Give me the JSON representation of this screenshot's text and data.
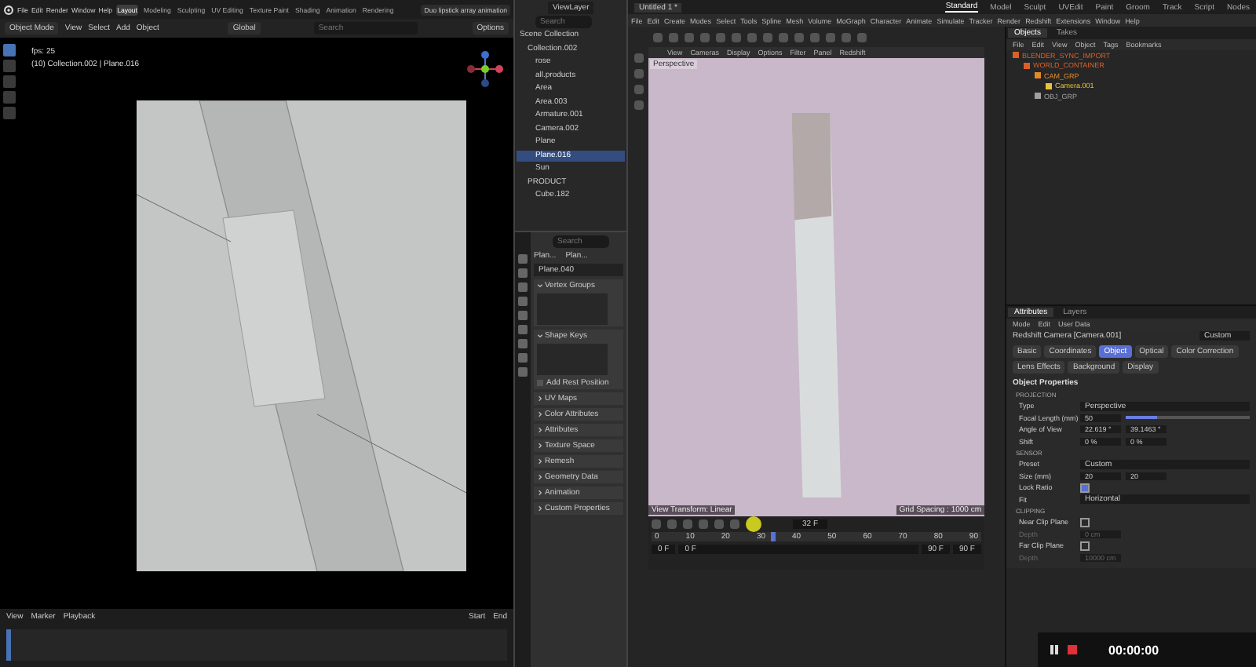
{
  "blender": {
    "menus": [
      "File",
      "Edit",
      "Render",
      "Window",
      "Help"
    ],
    "workspaces": [
      {
        "label": "Layout",
        "selected": true
      },
      {
        "label": "Modeling",
        "selected": false
      },
      {
        "label": "Sculpting",
        "selected": false
      },
      {
        "label": "UV Editing",
        "selected": false
      },
      {
        "label": "Texture Paint",
        "selected": false
      },
      {
        "label": "Shading",
        "selected": false
      },
      {
        "label": "Animation",
        "selected": false
      },
      {
        "label": "Rendering",
        "selected": false
      }
    ],
    "scene": "Duo lipstick array animation",
    "header": {
      "mode": "Object Mode",
      "menus": [
        "View",
        "Select",
        "Add",
        "Object"
      ],
      "orientation": "Global",
      "options": "Options",
      "search_placeholder": "Search"
    },
    "viewport": {
      "fps": "fps: 25",
      "context": "(10) Collection.002 | Plane.016"
    },
    "timeline": {
      "menus": [
        "View",
        "Marker",
        "Playback"
      ],
      "start_label": "Start",
      "end_label": "End"
    }
  },
  "outliner": {
    "view_layer": "ViewLayer",
    "search_placeholder": "Search",
    "tree": [
      {
        "label": "Scene Collection",
        "selected": false,
        "children": [
          {
            "label": "Collection.002",
            "selected": false,
            "children": [
              {
                "label": "rose",
                "selected": false
              },
              {
                "label": "all.products",
                "selected": false
              },
              {
                "label": "Area",
                "selected": false
              },
              {
                "label": "Area.003",
                "selected": false
              },
              {
                "label": "Armature.001",
                "selected": false
              },
              {
                "label": "Camera.002",
                "selected": false
              },
              {
                "label": "Plane",
                "selected": false
              },
              {
                "label": "Plane.016",
                "selected": true
              },
              {
                "label": "Sun",
                "selected": false
              }
            ]
          },
          {
            "label": "PRODUCT",
            "selected": false,
            "children": [
              {
                "label": "Cube.182",
                "selected": false
              }
            ]
          }
        ]
      }
    ]
  },
  "properties": {
    "search_placeholder": "Search",
    "breadcrumbs": [
      "Plan...",
      "Plan..."
    ],
    "mesh_name": "Plane.040",
    "panels": [
      {
        "title": "Vertex Groups",
        "expanded": true
      },
      {
        "title": "Shape Keys",
        "expanded": true,
        "checkbox": {
          "label": "Add Rest Position",
          "checked": false
        }
      },
      {
        "title": "UV Maps",
        "expanded": false
      },
      {
        "title": "Color Attributes",
        "expanded": false
      },
      {
        "title": "Attributes",
        "expanded": false
      },
      {
        "title": "Texture Space",
        "expanded": false
      },
      {
        "title": "Remesh",
        "expanded": false
      },
      {
        "title": "Geometry Data",
        "expanded": false
      },
      {
        "title": "Animation",
        "expanded": false
      },
      {
        "title": "Custom Properties",
        "expanded": false
      }
    ]
  },
  "c4d": {
    "document_tab": "Untitled 1 *",
    "layouts": [
      {
        "label": "Standard",
        "selected": true
      },
      {
        "label": "Model",
        "selected": false
      },
      {
        "label": "Sculpt",
        "selected": false
      },
      {
        "label": "UVEdit",
        "selected": false
      },
      {
        "label": "Paint",
        "selected": false
      },
      {
        "label": "Groom",
        "selected": false
      },
      {
        "label": "Track",
        "selected": false
      },
      {
        "label": "Script",
        "selected": false
      },
      {
        "label": "Nodes",
        "selected": false
      }
    ],
    "menus": [
      "File",
      "Edit",
      "Create",
      "Modes",
      "Select",
      "Tools",
      "Spline",
      "Mesh",
      "Volume",
      "MoGraph",
      "Character",
      "Animate",
      "Simulate",
      "Tracker",
      "Render",
      "Redshift",
      "Extensions",
      "Window",
      "Help"
    ],
    "viewport": {
      "menus": [
        "View",
        "Cameras",
        "Display",
        "Options",
        "Filter",
        "Panel",
        "Redshift"
      ],
      "camera_label": "Perspective",
      "transform_label": "View Transform: Linear",
      "grid_label": "Grid Spacing : 1000 cm"
    },
    "timeline": {
      "frame": "32 F",
      "level": 0.36,
      "ticks": [
        "0",
        "10",
        "20",
        "30",
        "40",
        "50",
        "60",
        "70",
        "80",
        "90"
      ],
      "range": [
        "0 F",
        "0 F",
        "90 F",
        "90 F"
      ]
    },
    "objects": {
      "tabs": [
        {
          "label": "Objects",
          "selected": true
        },
        {
          "label": "Takes",
          "selected": false
        }
      ],
      "menus": [
        "File",
        "Edit",
        "View",
        "Object",
        "Tags",
        "Bookmarks"
      ],
      "tree": [
        {
          "label": "BLENDER_SYNC_IMPORT",
          "color": "#d9602a",
          "children": [
            {
              "label": "WORLD_CONTAINER",
              "color": "#d9602a",
              "children": [
                {
                  "label": "CAM_GRP",
                  "color": "#e08a2c",
                  "children": [
                    {
                      "label": "Camera.001",
                      "color": "#e8c23a"
                    }
                  ]
                },
                {
                  "label": "OBJ_GRP",
                  "color": "#a0a0a0"
                }
              ]
            }
          ]
        }
      ]
    },
    "attributes": {
      "tabs": [
        {
          "label": "Attributes",
          "selected": true
        },
        {
          "label": "Layers",
          "selected": false
        }
      ],
      "menus": [
        "Mode",
        "Edit",
        "User Data"
      ],
      "title": "Redshift Camera [Camera.001]",
      "preset": "Custom",
      "object_tabs": [
        {
          "label": "Basic",
          "selected": false
        },
        {
          "label": "Coordinates",
          "selected": false
        },
        {
          "label": "Object",
          "selected": true
        },
        {
          "label": "Optical",
          "selected": false
        },
        {
          "label": "Color Correction",
          "selected": false
        },
        {
          "label": "Lens Effects",
          "selected": false
        },
        {
          "label": "Background",
          "selected": false
        },
        {
          "label": "Display",
          "selected": false
        }
      ],
      "heading": "Object Properties",
      "sections": [
        {
          "title": "PROJECTION",
          "rows": [
            {
              "kind": "dropdown",
              "label": "Type",
              "value": "Perspective",
              "disabled": false
            },
            {
              "kind": "slider",
              "label": "Focal Length (mm)",
              "value": "50",
              "level": 0.25,
              "disabled": false
            },
            {
              "kind": "pair",
              "label": "Angle of View",
              "values": [
                "22.619 °",
                "39.1463 °"
              ],
              "disabled": false
            },
            {
              "kind": "pair",
              "label": "Shift",
              "values": [
                "0 %",
                "0 %"
              ],
              "disabled": false
            }
          ]
        },
        {
          "title": "SENSOR",
          "rows": [
            {
              "kind": "dropdown",
              "label": "Preset",
              "value": "Custom",
              "disabled": false
            },
            {
              "kind": "pair",
              "label": "Size (mm)",
              "values": [
                "20",
                "20"
              ],
              "disabled": false
            },
            {
              "kind": "checkbox",
              "label": "Lock Ratio",
              "checked": true,
              "disabled": false
            },
            {
              "kind": "dropdown",
              "label": "Fit",
              "value": "Horizontal",
              "disabled": false
            }
          ]
        },
        {
          "title": "CLIPPING",
          "rows": [
            {
              "kind": "checkbox",
              "label": "Near Clip Plane",
              "checked": false,
              "disabled": false
            },
            {
              "kind": "field",
              "label": "Depth",
              "value": "0 cm",
              "disabled": true
            },
            {
              "kind": "checkbox",
              "label": "Far Clip Plane",
              "checked": false,
              "disabled": false
            },
            {
              "kind": "field",
              "label": "Depth",
              "value": "10000 cm",
              "disabled": true
            }
          ]
        }
      ]
    },
    "recorder": {
      "time": "00:00:00"
    }
  }
}
